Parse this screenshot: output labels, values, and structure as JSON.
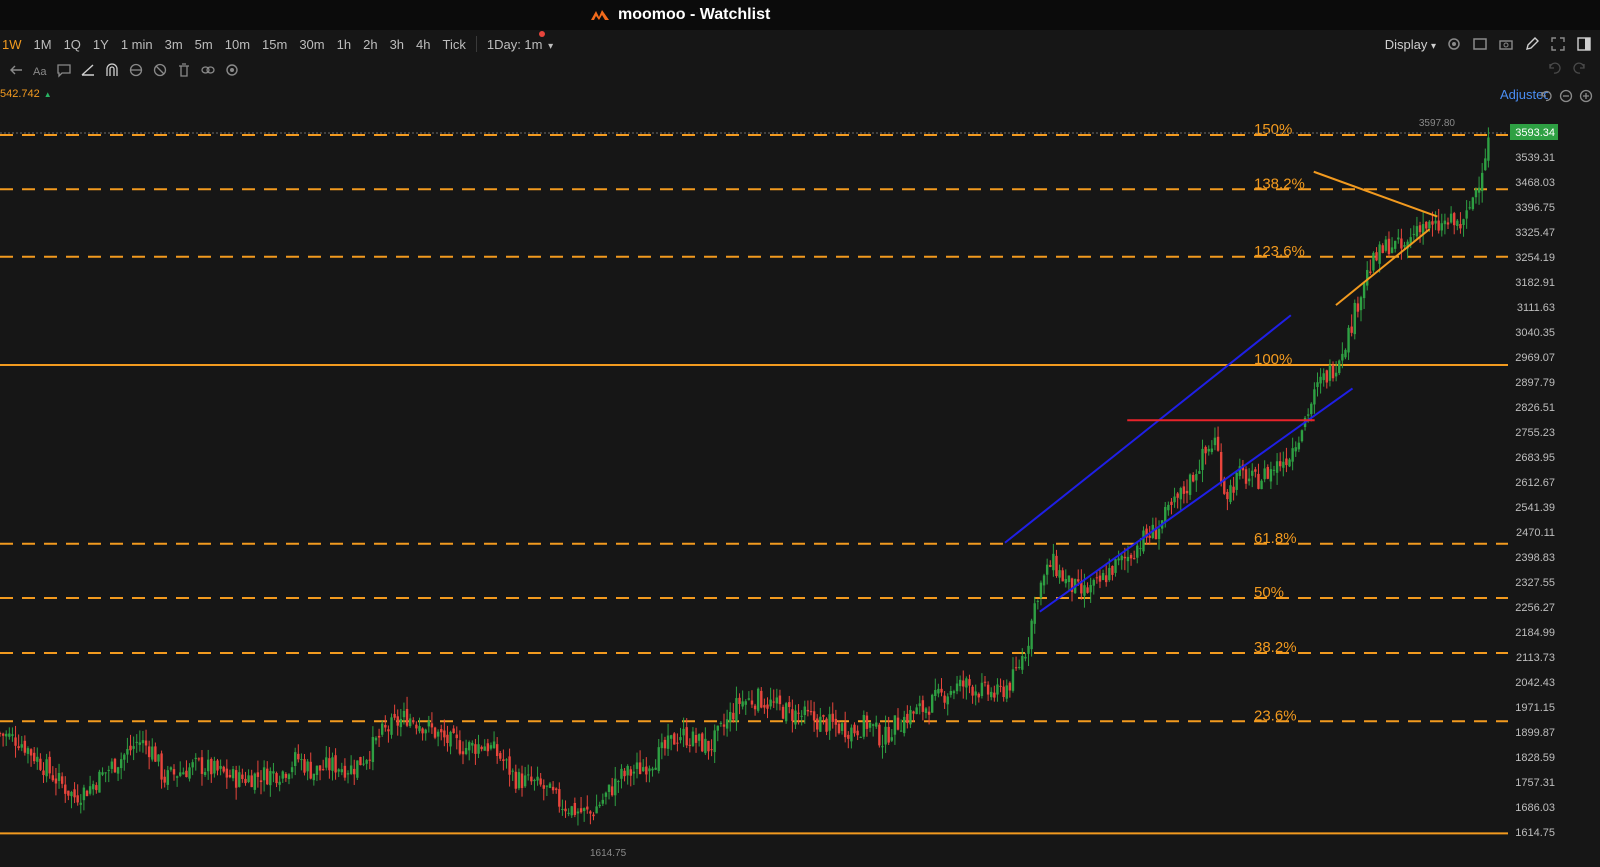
{
  "window": {
    "title": "moomoo - Watchlist"
  },
  "toolbar": {
    "timeframes": [
      "1W",
      "1M",
      "1Q",
      "1Y",
      "1 min",
      "3m",
      "5m",
      "10m",
      "15m",
      "30m",
      "1h",
      "2h",
      "3h",
      "4h",
      "Tick"
    ],
    "active_timeframe": "1W",
    "interval_select": "1Day: 1m",
    "display_label": "Display",
    "adjusted_label": "Adjusted"
  },
  "price_tag": "542.742",
  "colors": {
    "fib": "#f29a1f",
    "channel": "#1f1fe6",
    "resistance": "#e8232a",
    "triangle": "#f29a1f",
    "up": "#2ea043",
    "down": "#e8453c",
    "current": "#2ea043"
  },
  "icons": [
    "back-arrow-icon",
    "text-icon",
    "comment-icon",
    "trendline-icon",
    "magnet-icon",
    "pattern-icon",
    "hide-icon",
    "trash-icon",
    "link-icon",
    "settings-icon",
    "undo-icon",
    "redo-icon",
    "camera-icon",
    "expand-icon",
    "edit-icon",
    "layout-icon"
  ],
  "chart_data": {
    "type": "candlestick",
    "ylim": [
      1590,
      3650
    ],
    "y_ticks": [
      "3593.34",
      "3539.31",
      "3468.03",
      "3396.75",
      "3325.47",
      "3254.19",
      "3182.91",
      "3111.63",
      "3040.35",
      "2969.07",
      "2897.79",
      "2826.51",
      "2755.23",
      "2683.95",
      "2612.67",
      "2541.39",
      "2470.11",
      "2398.83",
      "2327.55",
      "2256.27",
      "2184.99",
      "2113.73",
      "2042.43",
      "1971.15",
      "1899.87",
      "1828.59",
      "1757.31",
      "1686.03",
      "1614.75"
    ],
    "current_price": "3593.34",
    "high_label": "3597.80",
    "low_label": "1614.75",
    "fib_levels": [
      {
        "label": "150%",
        "price": 3610,
        "style": "dashed"
      },
      {
        "label": "138.2%",
        "price": 3455,
        "style": "dashed"
      },
      {
        "label": "123.6%",
        "price": 3262,
        "style": "dashed"
      },
      {
        "label": "100%",
        "price": 2953,
        "style": "solid"
      },
      {
        "label": "61.8%",
        "price": 2442,
        "style": "dashed"
      },
      {
        "label": "50%",
        "price": 2287,
        "style": "dashed"
      },
      {
        "label": "38.2%",
        "price": 2130,
        "style": "dashed"
      },
      {
        "label": "23.6%",
        "price": 1935,
        "style": "dashed"
      },
      {
        "label": "",
        "price": 1614.75,
        "style": "solid"
      }
    ],
    "drawings": {
      "channel_upper": [
        [
          0.6664,
          2445
        ],
        [
          0.856,
          3095
        ]
      ],
      "channel_lower": [
        [
          0.6895,
          2248
        ],
        [
          0.8969,
          2886
        ]
      ],
      "resistance": [
        [
          0.7475,
          2795
        ],
        [
          0.8718,
          2795
        ]
      ],
      "triangle_upper": [
        [
          0.8712,
          3505
        ],
        [
          0.9532,
          3377
        ]
      ],
      "triangle_lower": [
        [
          0.8859,
          3124
        ],
        [
          0.948,
          3341
        ]
      ]
    },
    "path": [
      [
        0.0,
        1900
      ],
      [
        0.02,
        1880
      ],
      [
        0.04,
        1820
      ],
      [
        0.06,
        1760
      ],
      [
        0.075,
        1720
      ],
      [
        0.09,
        1745
      ],
      [
        0.11,
        1800
      ],
      [
        0.13,
        1850
      ],
      [
        0.14,
        1880
      ],
      [
        0.155,
        1850
      ],
      [
        0.165,
        1770
      ],
      [
        0.18,
        1790
      ],
      [
        0.2,
        1810
      ],
      [
        0.22,
        1790
      ],
      [
        0.24,
        1770
      ],
      [
        0.26,
        1780
      ],
      [
        0.285,
        1790
      ],
      [
        0.3,
        1830
      ],
      [
        0.315,
        1790
      ],
      [
        0.335,
        1810
      ],
      [
        0.355,
        1800
      ],
      [
        0.37,
        1840
      ],
      [
        0.385,
        1900
      ],
      [
        0.41,
        1950
      ],
      [
        0.43,
        1920
      ],
      [
        0.45,
        1880
      ],
      [
        0.47,
        1860
      ],
      [
        0.49,
        1870
      ],
      [
        0.505,
        1830
      ],
      [
        0.52,
        1770
      ],
      [
        0.535,
        1760
      ],
      [
        0.55,
        1740
      ],
      [
        0.565,
        1700
      ],
      [
        0.58,
        1680
      ],
      [
        0.595,
        1670
      ],
      [
        0.61,
        1720
      ],
      [
        0.625,
        1775
      ],
      [
        0.645,
        1800
      ],
      [
        0.665,
        1840
      ],
      [
        0.685,
        1900
      ],
      [
        0.7,
        1880
      ],
      [
        0.715,
        1860
      ],
      [
        0.73,
        1920
      ],
      [
        0.745,
        1990
      ],
      [
        0.765,
        2000
      ],
      [
        0.78,
        1980
      ],
      [
        0.795,
        1960
      ],
      [
        0.81,
        1950
      ],
      [
        0.83,
        1930
      ],
      [
        0.845,
        1920
      ],
      [
        0.86,
        1910
      ],
      [
        0.875,
        1930
      ],
      [
        0.89,
        1880
      ],
      [
        0.9,
        1920
      ],
      [
        0.915,
        1950
      ],
      [
        0.93,
        1970
      ],
      [
        0.945,
        2000
      ],
      [
        0.96,
        2030
      ],
      [
        0.975,
        2040
      ],
      [
        0.99,
        2020
      ],
      [
        1.005,
        2010
      ],
      [
        1.02,
        2050
      ],
      [
        1.035,
        2150
      ],
      [
        1.045,
        2300
      ],
      [
        1.06,
        2390
      ],
      [
        1.075,
        2330
      ],
      [
        1.09,
        2300
      ],
      [
        1.105,
        2320
      ],
      [
        1.12,
        2370
      ],
      [
        1.135,
        2400
      ],
      [
        1.15,
        2450
      ],
      [
        1.165,
        2480
      ],
      [
        1.18,
        2540
      ],
      [
        1.195,
        2600
      ],
      [
        1.21,
        2680
      ],
      [
        1.225,
        2740
      ],
      [
        1.235,
        2580
      ],
      [
        1.25,
        2640
      ],
      [
        1.265,
        2620
      ],
      [
        1.28,
        2650
      ],
      [
        1.3,
        2700
      ],
      [
        1.315,
        2800
      ],
      [
        1.33,
        2900
      ],
      [
        1.345,
        2950
      ],
      [
        1.36,
        3050
      ],
      [
        1.375,
        3200
      ],
      [
        1.385,
        3250
      ],
      [
        1.4,
        3300
      ],
      [
        1.415,
        3280
      ],
      [
        1.43,
        3360
      ],
      [
        1.445,
        3340
      ],
      [
        1.46,
        3360
      ],
      [
        1.475,
        3350
      ],
      [
        1.49,
        3480
      ],
      [
        1.5,
        3593
      ]
    ]
  }
}
